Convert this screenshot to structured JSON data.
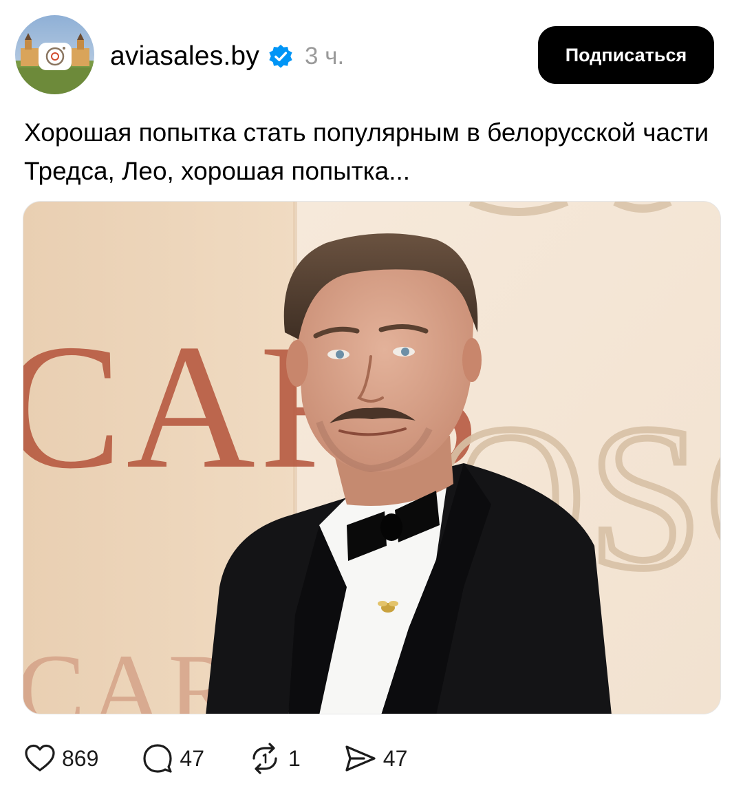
{
  "post": {
    "username": "aviasales.by",
    "verified": true,
    "time": "3 ч.",
    "follow_label": "Подписаться",
    "text": "Хорошая попытка стать популярным в белорусской части Тредса, Лео, хорошая попытка...",
    "image": {
      "backdrop_text_left": "CARS",
      "backdrop_text_left_bottom": "CARS",
      "backdrop_text_right": "OSC"
    }
  },
  "actions": {
    "likes": "869",
    "comments": "47",
    "reposts": "1",
    "shares": "47"
  },
  "icons": {
    "like": "heart-icon",
    "comment": "comment-bubble-icon",
    "repost": "repost-icon",
    "share": "send-icon",
    "verified": "verified-badge-icon"
  },
  "colors": {
    "verified_blue": "#0095f6",
    "button_bg": "#000000",
    "time_gray": "#9a9a9a"
  }
}
